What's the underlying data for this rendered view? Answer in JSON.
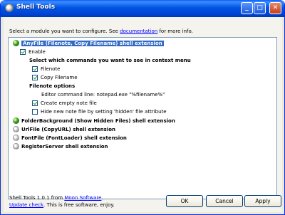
{
  "window": {
    "title": "Shell Tools"
  },
  "intro": {
    "text": "Select a module you want to configure. See",
    "link": "documentation",
    "suffix": "for more info."
  },
  "tree": {
    "anyfile": {
      "label": "AnyFile (Filenote, Copy Filename) shell extension",
      "enable_label": "Enable",
      "commands_heading": "Select which commands you want to see in context menu",
      "filenote_label": "Filenote",
      "copy_filename_label": "Copy Filename",
      "options_heading": "Filenote options",
      "editor_command": "Editor command line: notepad.exe \"%filename%\"",
      "create_empty_label": "Create empty note file",
      "hide_new_label": "Hide new note file by setting 'hidden' file attribute"
    },
    "other_modules": [
      {
        "label": "FolderBackground (Show Hidden Files) shell extension",
        "icon": "green-gear-icon"
      },
      {
        "label": "UrlFile (CopyURL) shell extension",
        "icon": "gray-gear-icon"
      },
      {
        "label": "FontFile (FontLoader) shell extension",
        "icon": "gray-gear-icon"
      },
      {
        "label": "RegisterServer shell extension",
        "icon": "gray-gear-icon"
      }
    ]
  },
  "footer": {
    "version_text": "Shell Tools 1.0.1 from",
    "vendor_link": "Moon Software",
    "update_link": "Update check",
    "update_suffix": ". This is free software, enjoy."
  },
  "buttons": {
    "ok": "OK",
    "cancel": "Cancel",
    "apply": "Apply"
  }
}
